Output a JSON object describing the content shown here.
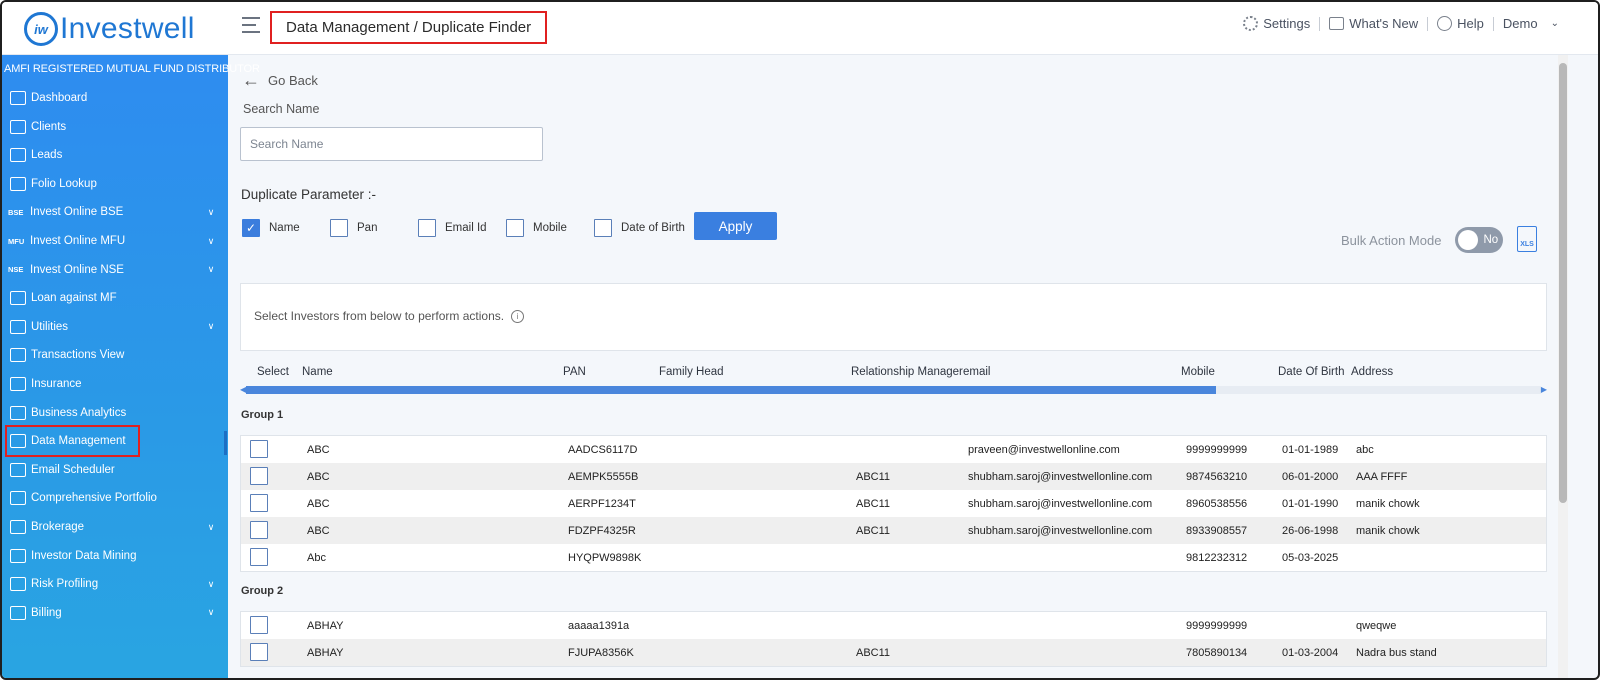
{
  "app": {
    "logo_text": "Investwell",
    "logo_mark": "iw"
  },
  "header": {
    "breadcrumb": "Data Management / Duplicate Finder",
    "settings": "Settings",
    "whats_new": "What's New",
    "help": "Help",
    "user": "Demo"
  },
  "sidebar": {
    "title": "AMFI REGISTERED MUTUAL FUND DISTRIBUTOR",
    "items": [
      {
        "label": "Dashboard",
        "icon": "home-icon"
      },
      {
        "label": "Clients",
        "icon": "users-icon"
      },
      {
        "label": "Leads",
        "icon": "leads-icon"
      },
      {
        "label": "Folio Lookup",
        "icon": "folio-icon"
      },
      {
        "label": "Invest Online BSE",
        "tag": "BSE",
        "expandable": true
      },
      {
        "label": "Invest Online MFU",
        "tag": "MFU",
        "expandable": true
      },
      {
        "label": "Invest Online NSE",
        "tag": "NSE",
        "expandable": true
      },
      {
        "label": "Loan against MF",
        "icon": "loan-icon"
      },
      {
        "label": "Utilities",
        "icon": "utilities-icon",
        "expandable": true
      },
      {
        "label": "Transactions View",
        "icon": "transfer-icon"
      },
      {
        "label": "Insurance",
        "icon": "insurance-icon"
      },
      {
        "label": "Business Analytics",
        "icon": "analytics-icon"
      },
      {
        "label": "Data Management",
        "icon": "database-icon",
        "active": true
      },
      {
        "label": "Email Scheduler",
        "icon": "email-icon"
      },
      {
        "label": "Comprehensive Portfolio",
        "icon": "portfolio-icon"
      },
      {
        "label": "Brokerage",
        "icon": "brokerage-icon",
        "expandable": true
      },
      {
        "label": "Investor Data Mining",
        "icon": "rupee-icon"
      },
      {
        "label": "Risk Profiling",
        "icon": "risk-icon",
        "expandable": true
      },
      {
        "label": "Billing",
        "icon": "billing-icon",
        "expandable": true
      }
    ]
  },
  "main": {
    "go_back": "Go Back",
    "search_label": "Search Name",
    "search_placeholder": "Search Name",
    "duplicate_label": "Duplicate Parameter :-",
    "params": [
      {
        "label": "Name",
        "checked": true
      },
      {
        "label": "Pan",
        "checked": false
      },
      {
        "label": "Email Id",
        "checked": false
      },
      {
        "label": "Mobile",
        "checked": false
      },
      {
        "label": "Date of Birth",
        "checked": false
      }
    ],
    "apply": "Apply",
    "bulk_action_label": "Bulk Action Mode",
    "bulk_action_value": "No",
    "xls_label": "XLS",
    "select_hint": "Select Investors from below to perform actions.",
    "columns": [
      "Select",
      "Name",
      "PAN",
      "Family Head",
      "Relationship Manager",
      "email",
      "Mobile",
      "Date Of Birth",
      "Address"
    ],
    "groups": [
      {
        "label": "Group 1",
        "rows": [
          {
            "name": "ABC",
            "pan": "AADCS6117D",
            "family_head": "",
            "rm": "",
            "email": "praveen@investwellonline.com",
            "mobile": "9999999999",
            "dob": "01-01-1989",
            "address": "abc"
          },
          {
            "name": "ABC",
            "pan": "AEMPK5555B",
            "family_head": "",
            "rm": "ABC11",
            "email": "shubham.saroj@investwellonline.com",
            "mobile": "9874563210",
            "dob": "06-01-2000",
            "address": "AAA FFFF"
          },
          {
            "name": "ABC",
            "pan": "AERPF1234T",
            "family_head": "",
            "rm": "ABC11",
            "email": "shubham.saroj@investwellonline.com",
            "mobile": "8960538556",
            "dob": "01-01-1990",
            "address": "manik chowk"
          },
          {
            "name": "ABC",
            "pan": "FDZPF4325R",
            "family_head": "",
            "rm": "ABC11",
            "email": "shubham.saroj@investwellonline.com",
            "mobile": "8933908557",
            "dob": "26-06-1998",
            "address": "manik chowk"
          },
          {
            "name": "Abc",
            "pan": "HYQPW9898K",
            "family_head": "",
            "rm": "",
            "email": "",
            "mobile": "9812232312",
            "dob": "05-03-2025",
            "address": ""
          }
        ]
      },
      {
        "label": "Group 2",
        "rows": [
          {
            "name": "ABHAY",
            "pan": "aaaaa1391a",
            "family_head": "",
            "rm": "",
            "email": "",
            "mobile": "9999999999",
            "dob": "",
            "address": "qweqwe"
          },
          {
            "name": "ABHAY",
            "pan": "FJUPA8356K",
            "family_head": "",
            "rm": "ABC11",
            "email": "",
            "mobile": "7805890134",
            "dob": "01-03-2004",
            "address": "Nadra bus stand"
          }
        ]
      }
    ]
  }
}
